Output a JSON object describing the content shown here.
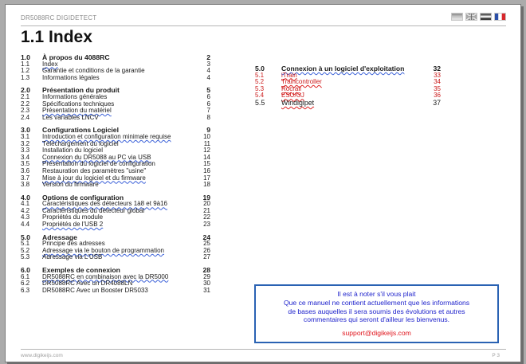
{
  "header": {
    "doc_title": "DR5088RC DIGIDETECT",
    "languages": [
      {
        "icon": "flag-de-icon",
        "lang": "de"
      },
      {
        "icon": "flag-uk-icon",
        "lang": "en"
      },
      {
        "icon": "flag-nl-icon",
        "lang": "nl"
      },
      {
        "icon": "flag-fr-icon",
        "lang": "fr"
      }
    ]
  },
  "page_title": "1.1 Index",
  "toc_left": [
    {
      "num": "1.0",
      "text": "À propos du 4088RC",
      "page": "2",
      "head": true
    },
    {
      "num": "1.1",
      "text": "Index",
      "page": "3"
    },
    {
      "num": "1.2",
      "text": "Garantie et conditions de la garantie",
      "page": "4"
    },
    {
      "num": "1.3",
      "text": "Informations légales",
      "page": "4"
    },
    {
      "num": "2.0",
      "text": "Présentation du produit",
      "page": "5",
      "head": true
    },
    {
      "num": "2.1",
      "text": "Informations générales",
      "page": "6"
    },
    {
      "num": "2.2",
      "text": "Spécifications techniques",
      "page": "6"
    },
    {
      "num": "2.3",
      "text": "Présentation du matériel",
      "page": "7"
    },
    {
      "num": "2.4",
      "text": "Les variables LNCV",
      "page": "8"
    },
    {
      "num": "3.0",
      "text": "Configurations Logiciel",
      "page": "9",
      "head": true
    },
    {
      "num": "3.1",
      "text": "Introduction et configuration minimale requise",
      "page": "10"
    },
    {
      "num": "3.2",
      "text": "Téléchargement du logiciel",
      "page": "11"
    },
    {
      "num": "3.3",
      "text": "Installation du logiciel",
      "page": "12"
    },
    {
      "num": "3.4",
      "text": "Connexion du DR5088 au PC via USB",
      "page": "14"
    },
    {
      "num": "3.5",
      "text": "Présentation du logiciel de configuration",
      "page": "15"
    },
    {
      "num": "3.6",
      "text": "Restauration des paramètres \"usine\"",
      "page": "16"
    },
    {
      "num": "3.7",
      "text": "Mise à jour du logiciel et du firmware",
      "page": "17"
    },
    {
      "num": "3.8",
      "text": "Version du firmware",
      "page": "18"
    },
    {
      "num": "4.0",
      "text": "Options de configuration",
      "page": "19",
      "head": true
    },
    {
      "num": "4.1",
      "text": "Caractéristiques des détecteurs 1à8 et 9à16",
      "page": "20"
    },
    {
      "num": "4.2",
      "text": "Caractéristiques du détecteur global",
      "page": "21"
    },
    {
      "num": "4.3",
      "text": "Propriétés du module",
      "page": "22"
    },
    {
      "num": "4.4",
      "text": "Propriétés de l'USB 2",
      "page": "23"
    },
    {
      "num": "5.0",
      "text": "Adressage",
      "page": "24",
      "head": true
    },
    {
      "num": "5.1",
      "text": "Principe des adresses",
      "page": "25"
    },
    {
      "num": "5.2",
      "text": "Adressage via le bouton de programmation",
      "page": "26"
    },
    {
      "num": "5.3",
      "text": "Adressage via L'USB",
      "page": "27"
    },
    {
      "num": "6.0",
      "text": "Exemples de connexion",
      "page": "28",
      "head": true
    },
    {
      "num": "6.1",
      "text": "DR5088RC en combinaison avec la DR5000",
      "page": "29"
    },
    {
      "num": "6.2",
      "text": "DR5088RC Avec un DR4088LN",
      "page": "30"
    },
    {
      "num": "6.3",
      "text": "DR5088RC Avec un Booster DR5033",
      "page": "31"
    }
  ],
  "toc_right": [
    {
      "num": "5.0",
      "text": "Connexion à un logiciel d'exploitation",
      "page": "32",
      "head": true
    },
    {
      "num": "5.1",
      "text": "iTrain",
      "page": "33",
      "red": true
    },
    {
      "num": "5.2",
      "text": "Traincontroller",
      "page": "34",
      "red": true
    },
    {
      "num": "5.3",
      "text": "Rocrail",
      "page": "35",
      "red": true
    },
    {
      "num": "5.4",
      "text": "ESU/GJ",
      "page": "36",
      "red": true
    },
    {
      "num": "5.5",
      "text": "Windigipet",
      "page": "37",
      "big": true
    }
  ],
  "notice": {
    "line1": "Il est à noter s'il vous plait",
    "line2": "Que ce manuel ne contient actuellement que les informations",
    "line3": "de bases auquelles il sera soumis des évolutions et autres",
    "line4": "commentaires qui seront d'ailleur les bienvenus.",
    "email": "support@digikeijs.com"
  },
  "footer": {
    "website": "www.digikeijs.com",
    "page_number": "P 3"
  },
  "colors": {
    "notice_border": "#2a62b3",
    "notice_text": "#1f23cc",
    "email": "#e0141c",
    "red_entries": "#cc1a1a"
  }
}
